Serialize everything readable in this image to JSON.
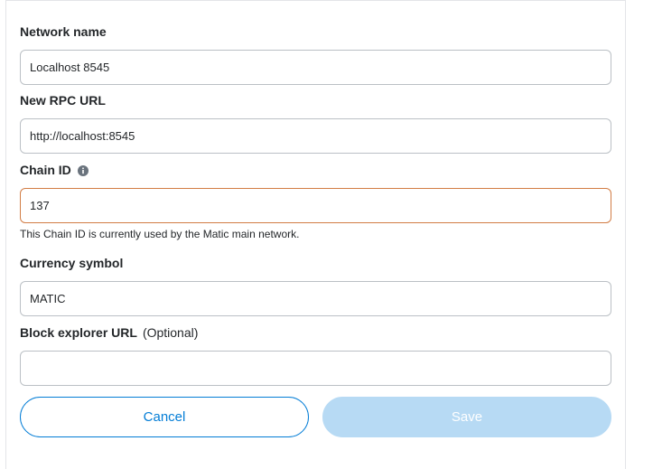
{
  "form": {
    "network_name": {
      "label": "Network name",
      "value": "Localhost 8545"
    },
    "rpc_url": {
      "label": "New RPC URL",
      "value": "http://localhost:8545"
    },
    "chain_id": {
      "label": "Chain ID",
      "value": "137",
      "helper": "This Chain ID is currently used by the Matic main network."
    },
    "currency_symbol": {
      "label": "Currency symbol",
      "value": "MATIC"
    },
    "block_explorer": {
      "label": "Block explorer URL",
      "optional": "(Optional)",
      "value": ""
    }
  },
  "buttons": {
    "cancel_label": "Cancel",
    "save_label": "Save"
  },
  "colors": {
    "primary": "#037dd6",
    "primary_disabled": "#b7daf4",
    "error_border": "#d27d45",
    "input_border": "#bbc0c5"
  },
  "icons": {
    "chain_id_info": "info-icon"
  }
}
